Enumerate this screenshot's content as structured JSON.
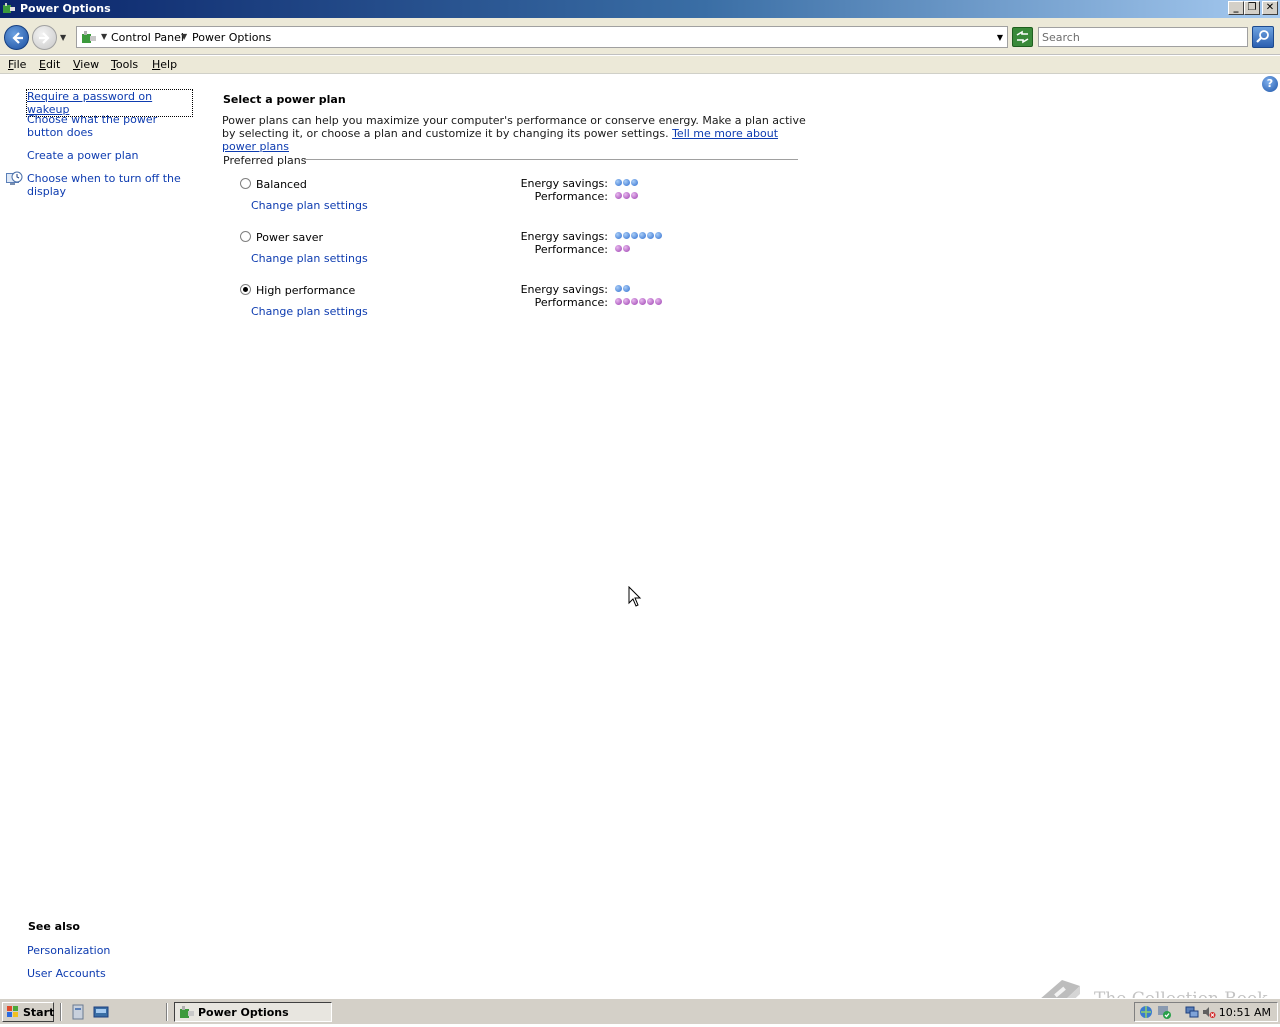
{
  "window": {
    "title": "Power Options",
    "minimize_label": "_",
    "restore_label": "❐",
    "close_label": "✕"
  },
  "address": {
    "crumbs": [
      "Control Panel",
      "Power Options"
    ],
    "search_placeholder": "Search"
  },
  "menu": {
    "items": [
      {
        "accel": "F",
        "rest": "ile"
      },
      {
        "accel": "E",
        "rest": "dit"
      },
      {
        "accel": "V",
        "rest": "iew"
      },
      {
        "accel": "T",
        "rest": "ools"
      },
      {
        "accel": "H",
        "rest": "elp"
      }
    ]
  },
  "help_icon_label": "?",
  "tasks": [
    "Require a password on wakeup",
    "Choose what the power button does",
    "Create a power plan",
    "Choose when to turn off the display"
  ],
  "main": {
    "heading": "Select a power plan",
    "intro_text": "Power plans can help you maximize your computer's performance or conserve energy. Make a plan active by selecting it, or choose a plan and customize it by changing its power settings. ",
    "intro_link": "Tell me more about power plans",
    "group_label": "Preferred plans",
    "energy_label": "Energy savings:",
    "performance_label": "Performance:",
    "change_link": "Change plan settings",
    "plans": [
      {
        "name": "Balanced",
        "selected": false,
        "energy_savings": 3,
        "performance": 3
      },
      {
        "name": "Power saver",
        "selected": false,
        "energy_savings": 6,
        "performance": 2
      },
      {
        "name": "High performance",
        "selected": true,
        "energy_savings": 2,
        "performance": 6
      }
    ]
  },
  "see_also": {
    "title": "See also",
    "links": [
      "Personalization",
      "User Accounts"
    ]
  },
  "watermark": "The Collection Book",
  "taskbar": {
    "start_label": "Start",
    "task_label": "Power Options",
    "clock": "10:51 AM"
  },
  "colors": {
    "link": "#0e3cb0",
    "energy_dot": "#2f6ed0",
    "performance_dot": "#9b3fb0"
  }
}
